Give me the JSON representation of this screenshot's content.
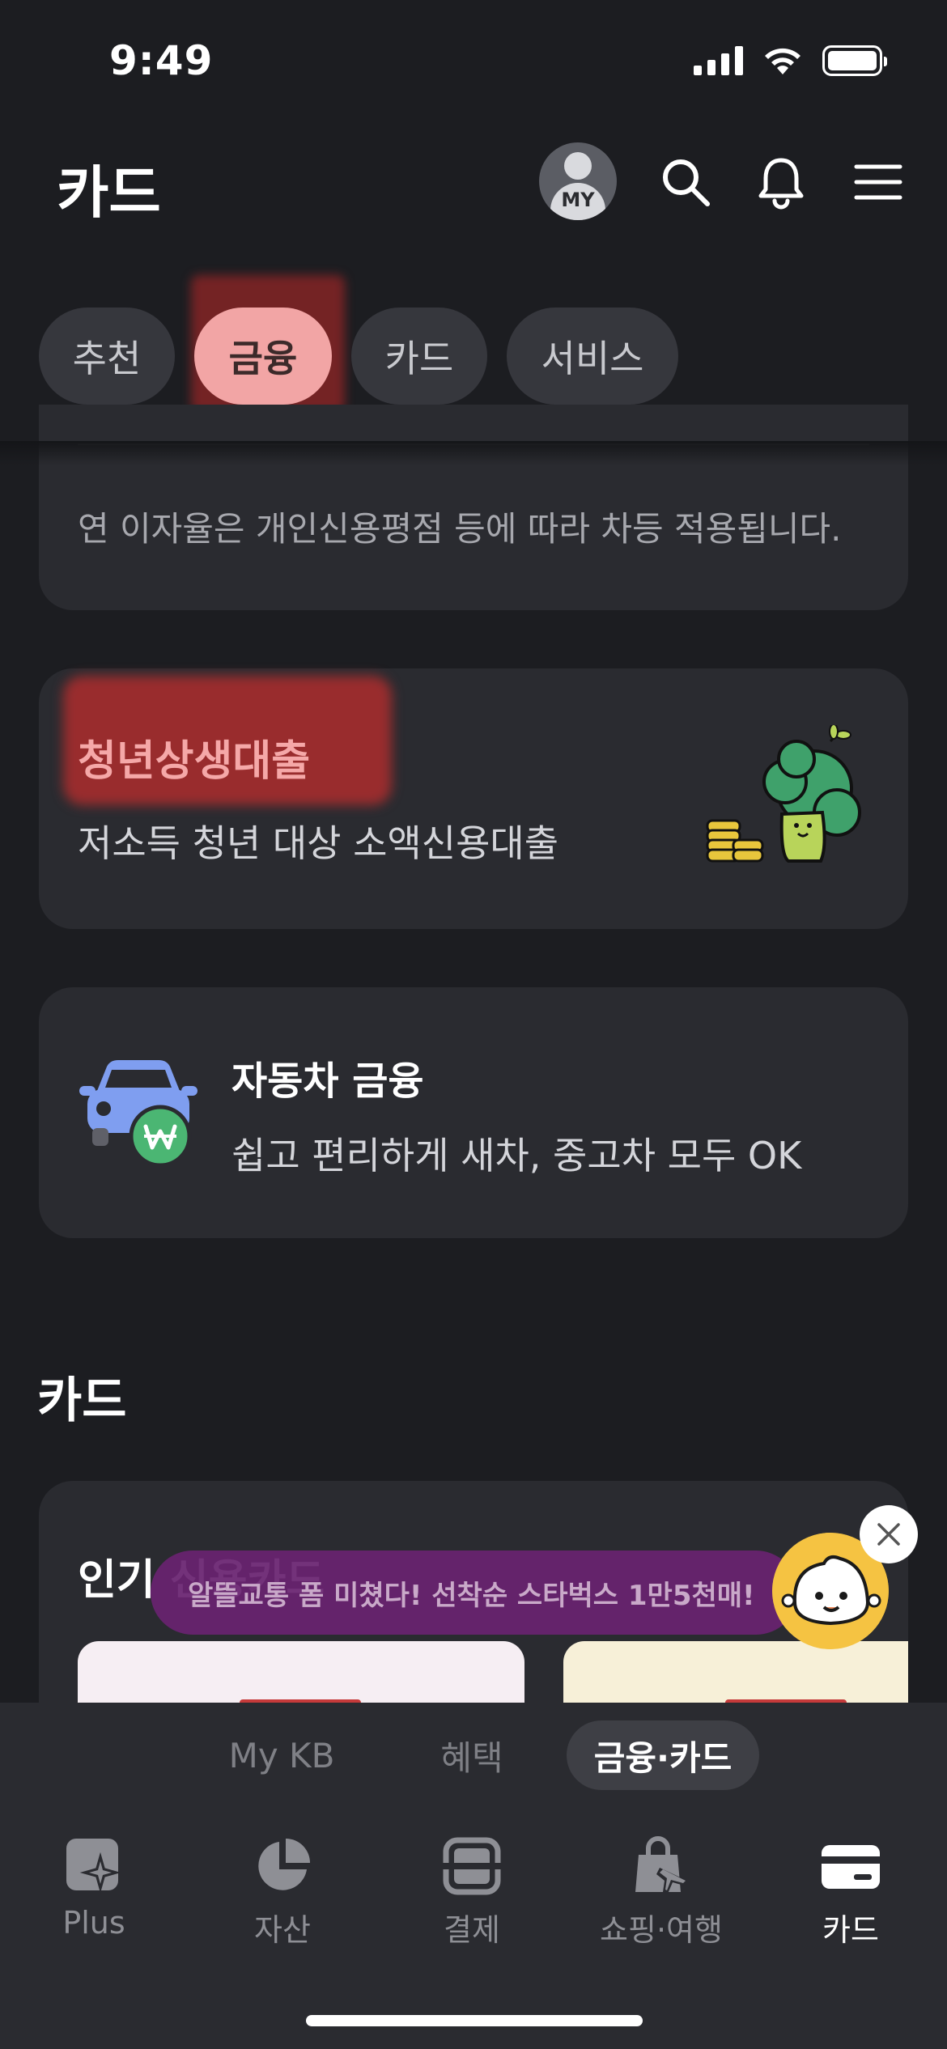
{
  "status_bar": {
    "time": "9:49"
  },
  "header": {
    "title": "카드",
    "avatar_label": "MY"
  },
  "tabs": [
    {
      "label": "추천",
      "active": false
    },
    {
      "label": "금융",
      "active": true
    },
    {
      "label": "카드",
      "active": false
    },
    {
      "label": "서비스",
      "active": false
    }
  ],
  "finance": {
    "rate_notice": "연 이자율은 개인신용평점 등에 따라 차등 적용됩니다.",
    "youth_loan": {
      "title": "청년상생대출",
      "subtitle": "저소득 청년 대상 소액신용대출"
    },
    "car_finance": {
      "title": "자동차 금융",
      "subtitle": "쉽고 편리하게 새차, 중고차 모두 OK"
    }
  },
  "card_section": {
    "title": "카드",
    "popular_title": "인기 신용카드"
  },
  "promo_banner": {
    "text": "알뜰교통 폼 미쳤다! 선착순 스타벅스 1만5천매!"
  },
  "segment_tabs": [
    {
      "label": "My KB",
      "active": false
    },
    {
      "label": "혜택",
      "active": false
    },
    {
      "label": "금융·카드",
      "active": true
    }
  ],
  "bottom_nav": [
    {
      "label": "Plus",
      "icon": "plus-sparkle-icon",
      "active": false
    },
    {
      "label": "자산",
      "icon": "pie-chart-icon",
      "active": false
    },
    {
      "label": "결제",
      "icon": "scan-icon",
      "active": false
    },
    {
      "label": "쇼핑·여행",
      "icon": "shopping-bag-plane-icon",
      "active": false
    },
    {
      "label": "카드",
      "icon": "credit-card-icon",
      "active": true
    }
  ],
  "colors": {
    "background": "#1c1d21",
    "card": "#2a2b30",
    "accent_pink": "#f2a5a5",
    "banner_purple": "#682270",
    "mascot_yellow": "#f5c342"
  }
}
